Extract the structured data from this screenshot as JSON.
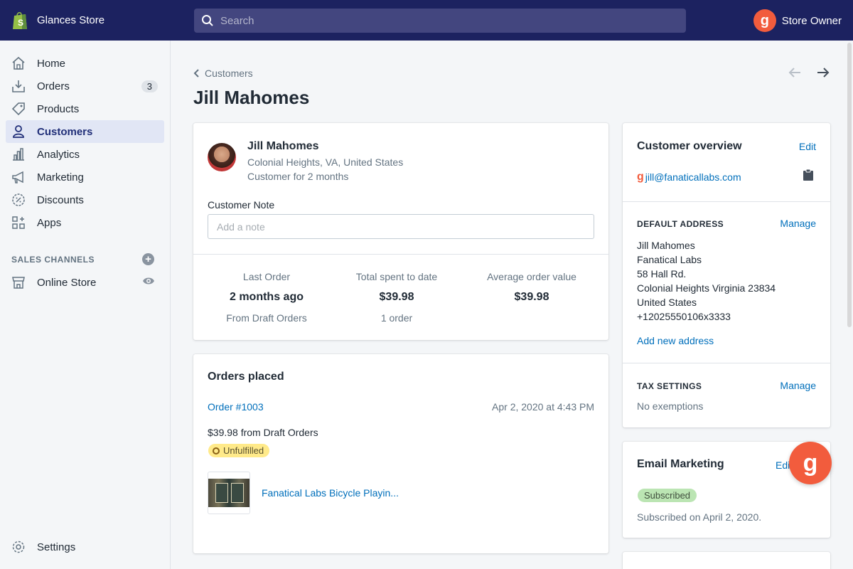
{
  "topbar": {
    "store_name": "Glances Store",
    "search_placeholder": "Search",
    "owner_name": "Store Owner",
    "owner_initial": "g"
  },
  "sidebar": {
    "items": [
      {
        "label": "Home",
        "icon": "home-icon"
      },
      {
        "label": "Orders",
        "icon": "orders-icon",
        "badge": "3"
      },
      {
        "label": "Products",
        "icon": "tag-icon"
      },
      {
        "label": "Customers",
        "icon": "person-icon",
        "active": true
      },
      {
        "label": "Analytics",
        "icon": "bar-chart-icon"
      },
      {
        "label": "Marketing",
        "icon": "megaphone-icon"
      },
      {
        "label": "Discounts",
        "icon": "discount-icon"
      },
      {
        "label": "Apps",
        "icon": "apps-icon"
      }
    ],
    "channels_label": "SALES CHANNELS",
    "online_store": "Online Store",
    "settings": "Settings"
  },
  "page": {
    "breadcrumb": "Customers",
    "title": "Jill Mahomes"
  },
  "profile": {
    "name": "Jill Mahomes",
    "location": "Colonial Heights, VA, United States",
    "customer_for": "Customer for 2 months",
    "note_label": "Customer Note",
    "note_placeholder": "Add a note",
    "stats": [
      {
        "label": "Last Order",
        "value": "2 months ago",
        "sub": "From Draft Orders"
      },
      {
        "label": "Total spent to date",
        "value": "$39.98",
        "sub": "1 order"
      },
      {
        "label": "Average order value",
        "value": "$39.98",
        "sub": ""
      }
    ]
  },
  "orders": {
    "title": "Orders placed",
    "order_number": "Order #1003",
    "order_date": "Apr 2, 2020 at 4:43 PM",
    "amount": "$39.98 from Draft Orders",
    "status": "Unfulfilled",
    "product": "Fanatical Labs Bicycle Playin..."
  },
  "overview": {
    "title": "Customer overview",
    "edit": "Edit",
    "email": "jill@fanaticallabs.com",
    "address_label": "DEFAULT ADDRESS",
    "manage": "Manage",
    "address_lines": [
      "Jill Mahomes",
      "Fanatical Labs",
      "58 Hall Rd.",
      "Colonial Heights Virginia 23834",
      "United States",
      "+12025550106x3333"
    ],
    "add_address": "Add new address",
    "tax_label": "TAX SETTINGS",
    "tax_manage": "Manage",
    "tax_value": "No exemptions"
  },
  "marketing": {
    "title": "Email Marketing",
    "edit": "Edit s",
    "status": "Subscribed",
    "subscribed_on": "Subscribed on April 2, 2020."
  },
  "colors": {
    "topbar": "#1c2260",
    "link": "#006fbb",
    "brand_orange": "#f25c3d",
    "unfulfilled": "#ffea8a",
    "subscribed": "#bbe5b3"
  }
}
